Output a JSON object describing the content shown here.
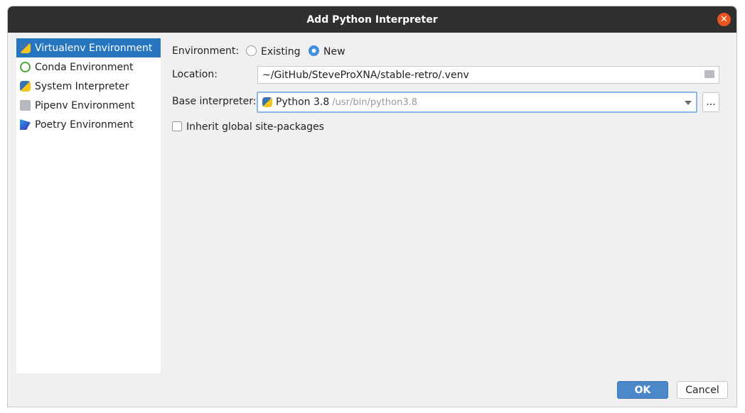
{
  "window": {
    "title": "Add Python Interpreter"
  },
  "sidebar": {
    "items": [
      {
        "label": "Virtualenv Environment",
        "icon": "virtualenv-icon",
        "selected": true
      },
      {
        "label": "Conda Environment",
        "icon": "conda-icon"
      },
      {
        "label": "System Interpreter",
        "icon": "python-icon"
      },
      {
        "label": "Pipenv Environment",
        "icon": "pipenv-icon"
      },
      {
        "label": "Poetry Environment",
        "icon": "poetry-icon"
      }
    ]
  },
  "form": {
    "environment_label": "Environment:",
    "existing_label": "Existing",
    "new_label": "New",
    "selected": "New",
    "location_label": "Location:",
    "location_value": "~/GitHub/SteveProXNA/stable-retro/.venv",
    "base_label": "Base interpreter:",
    "base_name": "Python 3.8",
    "base_path": "/usr/bin/python3.8",
    "browse_label": "...",
    "inherit_label": "Inherit global site-packages",
    "inherit_checked": false
  },
  "buttons": {
    "ok": "OK",
    "cancel": "Cancel"
  },
  "colors": {
    "accent": "#2675bf",
    "ok": "#4a88c8",
    "close": "#e95420"
  }
}
